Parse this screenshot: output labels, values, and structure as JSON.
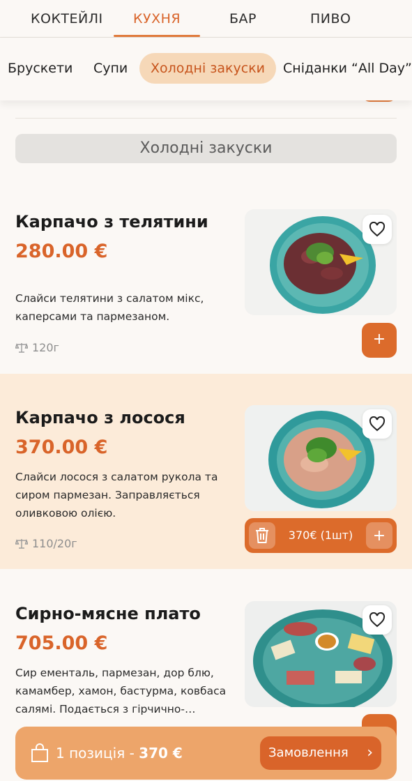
{
  "top_tabs": [
    {
      "label": "КОКТЕЙЛІ",
      "active": false
    },
    {
      "label": "КУХНЯ",
      "active": true
    },
    {
      "label": "БАР",
      "active": false
    },
    {
      "label": "ПИВО",
      "active": false
    }
  ],
  "categories": [
    {
      "label": "Брускети",
      "active": false
    },
    {
      "label": "Супи",
      "active": false
    },
    {
      "label": "Холодні закуски",
      "active": true
    },
    {
      "label": "Сніданки “All Day”",
      "active": false
    }
  ],
  "section_title": "Холодні закуски",
  "items": [
    {
      "title": "Карпачо з телятини",
      "price": "280.00 €",
      "description": "Слайси телятини з салатом мікс, каперсами та пармезаном.",
      "weight": "120г",
      "add_label": "+"
    },
    {
      "title": "Карпачо з лосося",
      "price": "370.00 €",
      "description": "Слайси лосося з салатом рукола та сиром пармезан. Заправляється оливковою олією.",
      "weight": "110/20г",
      "cart_text": "370€ (1шт)",
      "plus_label": "+"
    },
    {
      "title": "Сирно-мясне плато",
      "price": "705.00 €",
      "description": "Сир ементаль, пармезан, дор блю, камамбер, хамон, бастурма, ковбаса салямі. Подається з гірчично-…"
    }
  ],
  "order_bar": {
    "count_text": "1 позиція - ",
    "total": "370 €",
    "button_label": "Замовлення",
    "chevron": "›"
  },
  "colors": {
    "accent": "#dc6b2b",
    "accent_light": "#eda56a",
    "highlight_bg": "#fcebd9",
    "pill_active": "#f6d8b8"
  },
  "icons": [
    "heart-icon",
    "plus-icon",
    "trash-icon",
    "scale-icon",
    "shopping-bag-icon",
    "chevron-right-icon"
  ]
}
